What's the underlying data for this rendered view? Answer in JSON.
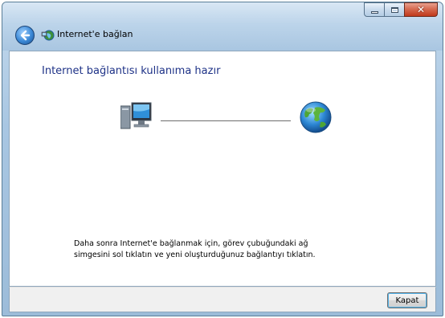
{
  "window": {
    "title": "Internet'e bağlan",
    "caption_buttons": {
      "minimize_icon": "minimize-icon",
      "maximize_icon": "maximize-icon",
      "close_icon": "close-icon"
    }
  },
  "wizard": {
    "heading": "Internet bağlantısı kullanıma hazır",
    "message_line1": "Daha sonra Internet'e bağlanmak için, görev çubuğundaki ağ",
    "message_line2": "simgesini sol tıklatın ve yeni oluşturduğunuz bağlantıyı tıklatın.",
    "computer_icon": "computer-icon",
    "globe_icon": "globe-icon"
  },
  "footer": {
    "close_label": "Kapat"
  },
  "colors": {
    "heading": "#1e3287",
    "close_button_accent": "#4fb1e8",
    "titlebar": "#bcd4ea"
  }
}
